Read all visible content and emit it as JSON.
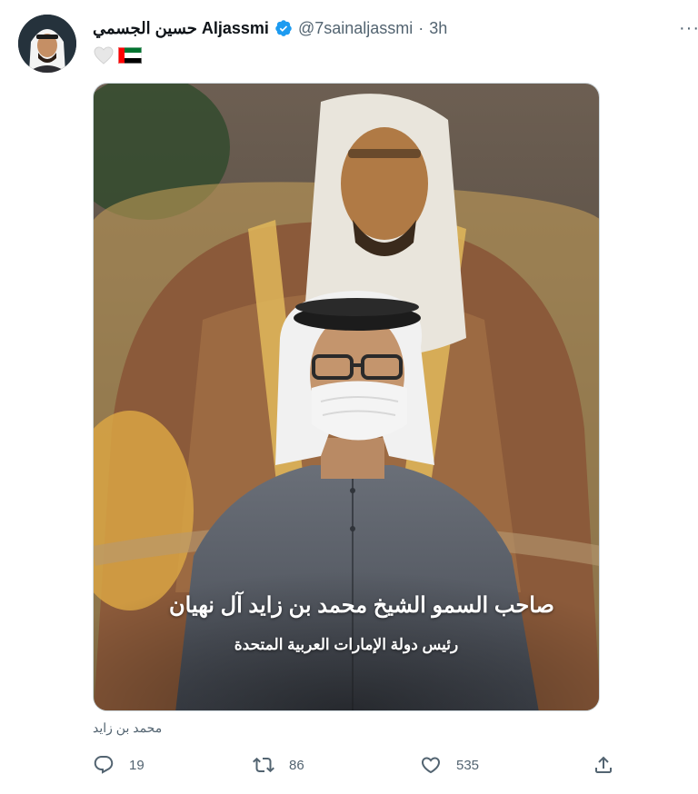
{
  "tweet": {
    "author_name": "حسين الجسمي Aljassmi",
    "handle": "@7sainaljassmi",
    "separator": "·",
    "time": "3h",
    "more": "···",
    "body_emoji_heart": "🤍",
    "body_flag_country": "UAE flag",
    "image_caption_line1": "صاحب السمو الشيخ محمد بن زايد آل نهيان",
    "image_caption_line2": "رئيس دولة الإمارات العربية المتحدة",
    "alt_tag": "محمد بن زايد"
  },
  "actions": {
    "reply_count": "19",
    "retweet_count": "86",
    "like_count": "535"
  },
  "colors": {
    "verified_blue": "#1d9bf0",
    "muted_text": "#536471"
  },
  "icons": [
    "verified-badge-icon",
    "more-options-icon",
    "reply-icon",
    "retweet-icon",
    "like-icon",
    "share-icon"
  ]
}
